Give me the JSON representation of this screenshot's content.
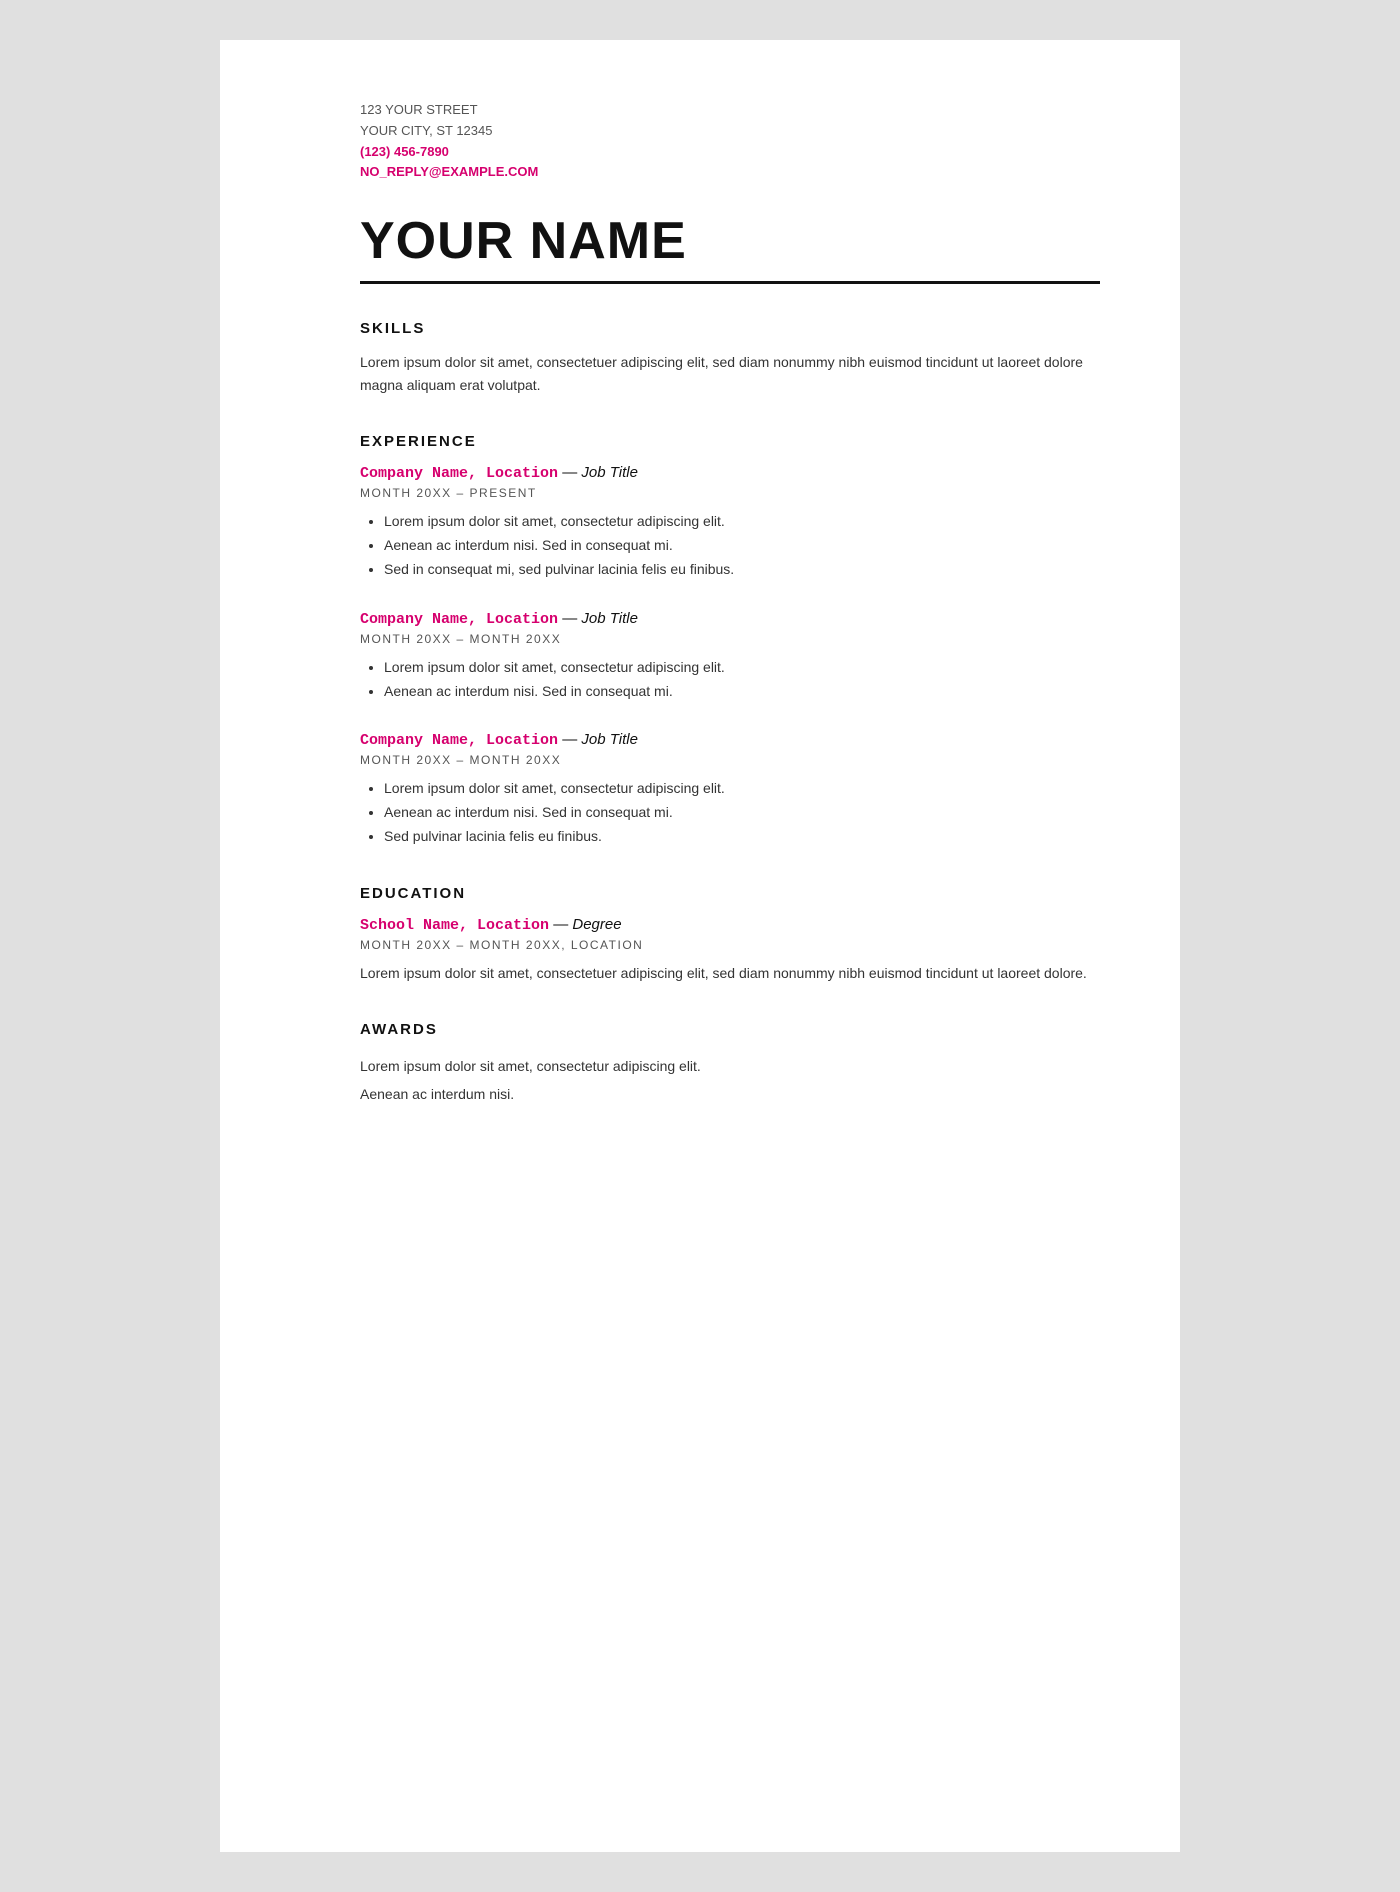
{
  "contact": {
    "street": "123 YOUR STREET",
    "city": "YOUR CITY, ST 12345",
    "phone": "(123) 456-7890",
    "email": "NO_REPLY@EXAMPLE.COM"
  },
  "name": "YOUR NAME",
  "sections": {
    "skills": {
      "title": "SKILLS",
      "text": "Lorem ipsum dolor sit amet, consectetuer adipiscing elit, sed diam nonummy nibh euismod tincidunt ut laoreet dolore magna aliquam erat volutpat."
    },
    "experience": {
      "title": "EXPERIENCE",
      "entries": [
        {
          "company": "Company Name, Location",
          "dash": " — ",
          "job_title": "Job Title",
          "dates": "MONTH 20XX – PRESENT",
          "bullets": [
            "Lorem ipsum dolor sit amet, consectetur adipiscing elit.",
            "Aenean ac interdum nisi. Sed in consequat mi.",
            "Sed in consequat mi, sed pulvinar lacinia felis eu finibus."
          ]
        },
        {
          "company": "Company Name, Location",
          "dash": " — ",
          "job_title": "Job Title",
          "dates": "MONTH 20XX – MONTH 20XX",
          "bullets": [
            "Lorem ipsum dolor sit amet, consectetur adipiscing elit.",
            "Aenean ac interdum nisi. Sed in consequat mi."
          ]
        },
        {
          "company": "Company Name, Location",
          "dash": " — ",
          "job_title": "Job Title",
          "dates": "MONTH 20XX – MONTH 20XX",
          "bullets": [
            "Lorem ipsum dolor sit amet, consectetur adipiscing elit.",
            "Aenean ac interdum nisi. Sed in consequat mi.",
            "Sed pulvinar lacinia felis eu finibus."
          ]
        }
      ]
    },
    "education": {
      "title": "EDUCATION",
      "entries": [
        {
          "school": "School Name, Location",
          "dash": " — ",
          "degree": "Degree",
          "dates": "MONTH 20XX – MONTH 20XX, LOCATION",
          "text": "Lorem ipsum dolor sit amet, consectetuer adipiscing elit, sed diam nonummy nibh euismod tincidunt ut laoreet dolore."
        }
      ]
    },
    "awards": {
      "title": "AWARDS",
      "lines": [
        "Lorem ipsum dolor sit amet, consectetur adipiscing elit.",
        "Aenean ac interdum nisi."
      ]
    }
  }
}
